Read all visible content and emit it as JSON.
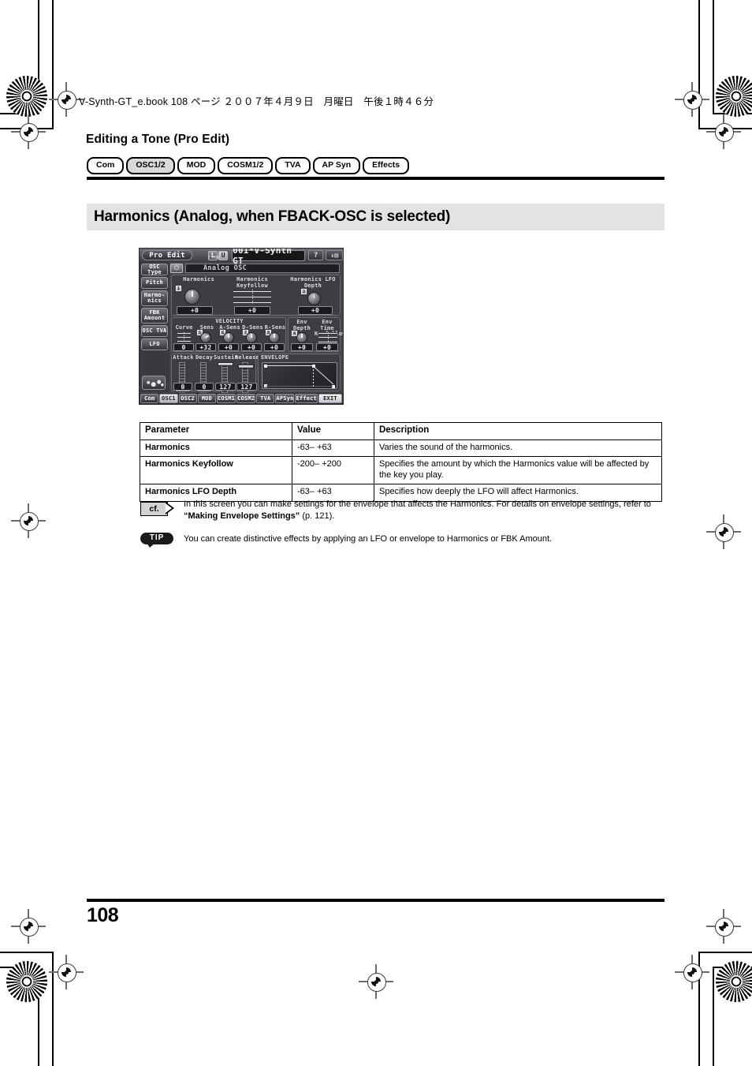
{
  "print_header": {
    "file_line": "V-Synth-GT_e.book 108 ページ ２００７年４月９日　月曜日　午後１時４６分"
  },
  "running_head": "Editing a Tone (Pro Edit)",
  "chapter_tabs": [
    {
      "label": "Com",
      "active": false
    },
    {
      "label": "OSC1/2",
      "active": true
    },
    {
      "label": "MOD",
      "active": false
    },
    {
      "label": "COSM1/2",
      "active": false
    },
    {
      "label": "TVA",
      "active": false
    },
    {
      "label": "AP Syn",
      "active": false
    },
    {
      "label": "Effects",
      "active": false
    }
  ],
  "section": {
    "title": "Harmonics (Analog, when FBACK-OSC is selected)"
  },
  "lcd": {
    "title_button": "Pro Edit",
    "lu_label": "TONE",
    "lu_keys": [
      "L",
      "U"
    ],
    "patch_name": "001*V-Synth GT",
    "help_button": "?",
    "menu_button": "↓▤",
    "rail_buttons": [
      "OSC Type",
      "Pitch",
      "Harmo-nics",
      "FBK Amount",
      "OSC TVA",
      "LFO"
    ],
    "osc_power_icon": "⏻",
    "osc_type_name": "Analog OSC",
    "top_params": [
      {
        "label": "Harmonics",
        "value": "+0",
        "badge": "1"
      },
      {
        "label": "Harmonics Keyfollow",
        "value": "+0",
        "badge": ""
      },
      {
        "label": "Harmonics LFO Depth",
        "value": "+0",
        "badge": "3"
      }
    ],
    "velocity_group_label": "VELOCITY",
    "velocity_params": [
      {
        "label": "Curve",
        "value": "0",
        "badge": ""
      },
      {
        "label": "Sens",
        "value": "+32",
        "badge": "5"
      },
      {
        "label": "A-Sens",
        "value": "+0",
        "badge": "6"
      },
      {
        "label": "D-Sens",
        "value": "+0",
        "badge": "7"
      },
      {
        "label": "R-Sens",
        "value": "+0",
        "badge": "8"
      }
    ],
    "env_params": [
      {
        "label": "Env Depth",
        "value": "+0",
        "badge": "4"
      },
      {
        "label": "Env Time Keyfollow",
        "value": "+0",
        "badge": ""
      }
    ],
    "adsr": [
      {
        "label": "Attack",
        "value": "0"
      },
      {
        "label": "Decay",
        "value": "0"
      },
      {
        "label": "Sustain",
        "value": "127"
      },
      {
        "label": "Release",
        "value": "127"
      }
    ],
    "envelope_label": "ENVELOPE",
    "bottom_tabs": [
      {
        "label": "Com",
        "on": false
      },
      {
        "label": "OSC1",
        "on": true
      },
      {
        "label": "OSC2",
        "on": false
      },
      {
        "label": "MOD",
        "on": false
      },
      {
        "label": "COSM1",
        "on": false
      },
      {
        "label": "COSM2",
        "on": false
      },
      {
        "label": "TVA",
        "on": false
      },
      {
        "label": "APSyn",
        "on": false
      },
      {
        "label": "Effect",
        "on": false
      }
    ],
    "exit_tab": "EXIT"
  },
  "table": {
    "headers": [
      "Parameter",
      "Value",
      "Description"
    ],
    "rows": [
      {
        "parameter": "Harmonics",
        "value": "-63– +63",
        "description": "Varies the sound of the harmonics."
      },
      {
        "parameter": "Harmonics Keyfollow",
        "value": "-200– +200",
        "description": "Specifies the amount by which the Harmonics value will be affected by the key you play."
      },
      {
        "parameter": "Harmonics LFO Depth",
        "value": "-63– +63",
        "description": "Specifies how deeply the LFO will affect Harmonics."
      }
    ]
  },
  "notes": {
    "cf": {
      "badge": "cf.",
      "text_a": "In this screen you can make settings for the envelope that affects the Harmonics. For details on envelope settings, refer to ",
      "ref": "“Making Envelope Settings”",
      "text_b": " (p. 121)."
    },
    "tip": {
      "badge": "TIP",
      "text": "You can create distinctive effects by applying an LFO or envelope to Harmonics or FBK Amount."
    }
  },
  "footer": {
    "page_number": "108"
  }
}
